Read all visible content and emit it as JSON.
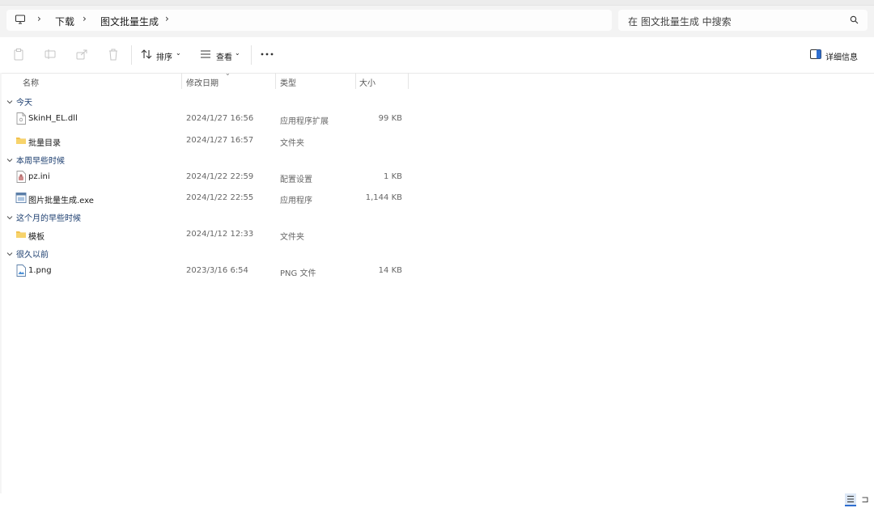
{
  "breadcrumb": {
    "items": [
      "下载",
      "图文批量生成"
    ]
  },
  "search": {
    "placeholder": "在 图文批量生成 中搜索"
  },
  "toolbar": {
    "sort_label": "排序",
    "view_label": "查看",
    "details_label": "详细信息"
  },
  "columns": {
    "name": "名称",
    "date": "修改日期",
    "type": "类型",
    "size": "大小"
  },
  "groups": [
    {
      "label": "今天",
      "files": [
        {
          "name": "SkinH_EL.dll",
          "date": "2024/1/27 16:56",
          "type": "应用程序扩展",
          "size": "99 KB",
          "icon": "dll-file-icon"
        },
        {
          "name": "批量目录",
          "date": "2024/1/27 16:57",
          "type": "文件夹",
          "size": "",
          "icon": "folder-icon"
        }
      ]
    },
    {
      "label": "本周早些时候",
      "files": [
        {
          "name": "pz.ini",
          "date": "2024/1/22 22:59",
          "type": "配置设置",
          "size": "1 KB",
          "icon": "ini-file-icon"
        },
        {
          "name": "图片批量生成.exe",
          "date": "2024/1/22 22:55",
          "type": "应用程序",
          "size": "1,144 KB",
          "icon": "exe-file-icon"
        }
      ]
    },
    {
      "label": "这个月的早些时候",
      "files": [
        {
          "name": "模板",
          "date": "2024/1/12 12:33",
          "type": "文件夹",
          "size": "",
          "icon": "folder-icon"
        }
      ]
    },
    {
      "label": "很久以前",
      "files": [
        {
          "name": "1.png",
          "date": "2023/3/16 6:54",
          "type": "PNG 文件",
          "size": "14 KB",
          "icon": "png-file-icon"
        }
      ]
    }
  ],
  "colors": {
    "group_header": "#1a3c6e",
    "folder": "#f2c14e",
    "accent": "#2f6fd1"
  }
}
